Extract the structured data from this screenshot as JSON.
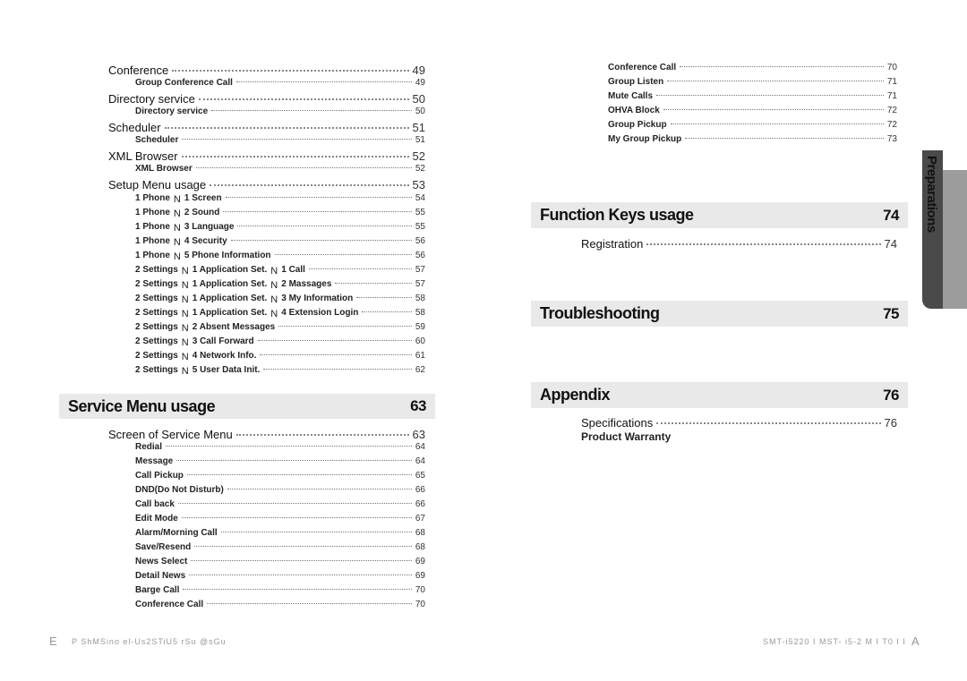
{
  "left_top": [
    {
      "type": "sec",
      "title": "Conference",
      "page": "49"
    },
    {
      "type": "sub",
      "title": "Group  Conference  Call",
      "page": "49"
    },
    {
      "type": "sec",
      "title": "Directory service",
      "page": "50"
    },
    {
      "type": "sub",
      "title": "Directory service",
      "page": "50"
    },
    {
      "type": "sec",
      "title": "Scheduler",
      "page": "51"
    },
    {
      "type": "sub",
      "title": "Scheduler",
      "page": "51"
    },
    {
      "type": "sec",
      "title": "XML Browser",
      "page": "52"
    },
    {
      "type": "sub",
      "title": "XML Browser",
      "page": "52"
    },
    {
      "type": "sec",
      "title": "Setup Menu usage",
      "page": "53"
    },
    {
      "type": "sub",
      "parts": [
        "1 Phone",
        "1  Screen"
      ],
      "page": "54"
    },
    {
      "type": "sub",
      "parts": [
        "1 Phone",
        "2 Sound"
      ],
      "page": "55"
    },
    {
      "type": "sub",
      "parts": [
        "1 Phone",
        "3 Language"
      ],
      "page": "55"
    },
    {
      "type": "sub",
      "parts": [
        "1 Phone",
        "4 Security"
      ],
      "page": "56"
    },
    {
      "type": "sub",
      "parts": [
        "1 Phone",
        "5 Phone Information"
      ],
      "page": "56"
    },
    {
      "type": "sub",
      "parts": [
        "2 Settings",
        "1 Application Set.",
        "1 Call"
      ],
      "page": "57"
    },
    {
      "type": "sub",
      "parts": [
        "2 Settings",
        "1 Application Set.",
        "2 Massages"
      ],
      "page": "57"
    },
    {
      "type": "sub",
      "parts": [
        "2 Settings",
        "1 Application Set.",
        "3 My Information"
      ],
      "page": "58"
    },
    {
      "type": "sub",
      "parts": [
        "2 Settings",
        "1 Application Set.",
        "4 Extension Login"
      ],
      "page": "58"
    },
    {
      "type": "sub",
      "parts": [
        "2 Settings",
        "2 Absent Messages"
      ],
      "page": "59"
    },
    {
      "type": "sub",
      "parts": [
        "2 Settings",
        "3 Call Forward"
      ],
      "page": "60"
    },
    {
      "type": "sub",
      "parts": [
        "2 Settings",
        "4 Network Info."
      ],
      "page": "61"
    },
    {
      "type": "sub",
      "parts": [
        "2 Settings",
        "5 User Data Init."
      ],
      "page": "62"
    }
  ],
  "arrow_glyph": "N",
  "service_header": {
    "title": "Service Menu usage",
    "page": "63"
  },
  "left_bottom": [
    {
      "type": "sec",
      "title": "Screen of Service Menu",
      "page": "63"
    },
    {
      "type": "sub",
      "title": "Redial",
      "page": "64"
    },
    {
      "type": "sub",
      "title": "Message",
      "page": "64"
    },
    {
      "type": "sub",
      "title": "Call Pickup",
      "page": "65"
    },
    {
      "type": "sub",
      "title": "DND(Do Not Disturb)",
      "page": "66"
    },
    {
      "type": "sub",
      "title": "Call back",
      "page": "66"
    },
    {
      "type": "sub",
      "title": "Edit  Mode",
      "page": "67"
    },
    {
      "type": "sub",
      "title": "Alarm/Morning Call",
      "page": "68"
    },
    {
      "type": "sub",
      "title": "Save/Resend",
      "page": "68"
    },
    {
      "type": "sub",
      "title": "News Select",
      "page": "69"
    },
    {
      "type": "sub",
      "title": "Detail  News",
      "page": "69"
    },
    {
      "type": "sub",
      "title": "Barge Call",
      "page": "70"
    },
    {
      "type": "sub",
      "title": "Conference Call",
      "page": "70"
    }
  ],
  "right_top": [
    {
      "type": "rsub",
      "title": "Conference Call",
      "page": "70"
    },
    {
      "type": "rsub",
      "title": "Group Listen",
      "page": "71"
    },
    {
      "type": "rsub",
      "title": "Mute Calls",
      "page": "71"
    },
    {
      "type": "rsub",
      "title": "OHVA Block",
      "page": "72"
    },
    {
      "type": "rsub",
      "title": "Group Pickup",
      "page": "72"
    },
    {
      "type": "rsub",
      "title": "My Group Pickup",
      "page": "73"
    }
  ],
  "function_header": {
    "title": "Function Keys usage",
    "page": "74"
  },
  "function_items": [
    {
      "type": "sec",
      "title": "Registration",
      "page": "74"
    }
  ],
  "trouble_header": {
    "title": "Troubleshooting",
    "page": "75"
  },
  "appendix_header": {
    "title": "Appendix",
    "page": "76"
  },
  "appendix_items": [
    {
      "type": "sec",
      "title": "Specifications",
      "page": "76"
    },
    {
      "type": "plain",
      "title": "Product Warranty"
    }
  ],
  "side_tab": {
    "label": "Preparations",
    "dark": "#4a4a4a",
    "light": "#9c9c9c"
  },
  "footer": {
    "left_letter": "E",
    "left_text": "P ShMSino el-Us2STiU5 rSu @sGu",
    "right_text": "SMT-i5220 I   MST- i5-2 M I T0 I I",
    "right_letter": "A"
  }
}
